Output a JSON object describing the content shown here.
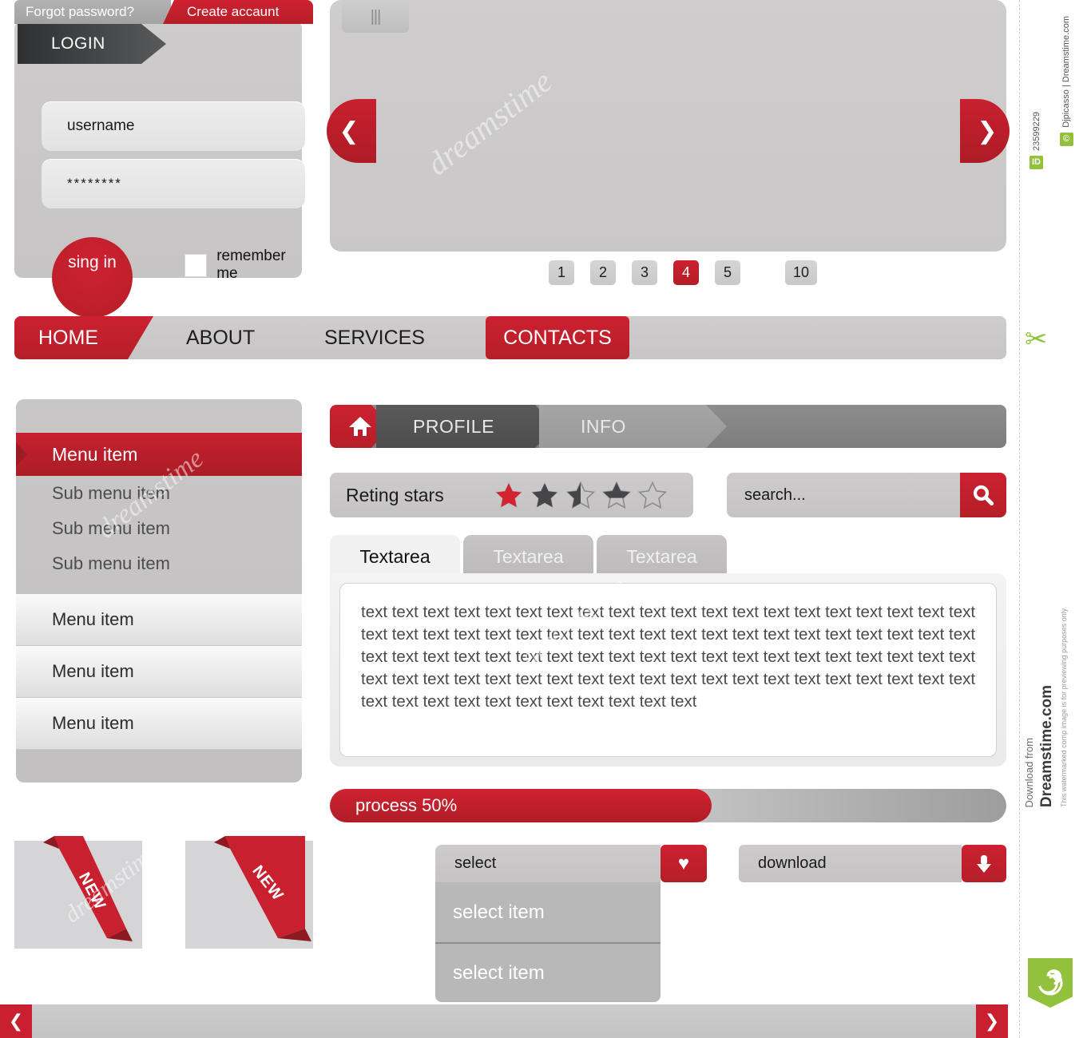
{
  "login": {
    "tab_forgot": "Forgot password?",
    "tab_create": "Create accaunt",
    "badge": "LOGIN",
    "username_value": "username",
    "password_value": "********",
    "signin_label": "sing in",
    "remember_label": "remember me"
  },
  "carousel": {
    "prev_icon": "chevron-left-icon",
    "next_icon": "chevron-right-icon",
    "prev_glyph": "❮",
    "next_glyph": "❯",
    "pages": [
      "1",
      "2",
      "3",
      "4",
      "5",
      "10"
    ],
    "active_page": "4"
  },
  "top_nav": {
    "home": "HOME",
    "about": "ABOUT",
    "services": "SERVICES",
    "contacts": "CONTACTS"
  },
  "sidebar": {
    "head": "Menu item",
    "sub_items": [
      "Sub menu item",
      "Sub menu item",
      "Sub menu item"
    ],
    "items": [
      "Menu item",
      "Menu item",
      "Menu item"
    ]
  },
  "breadcrumb": {
    "home_icon": "home-icon",
    "profile": "PROFILE",
    "info": "INFO"
  },
  "rating": {
    "label": "Reting stars",
    "stars": [
      "full-red",
      "full-dark",
      "half-dark",
      "partial-dark",
      "empty"
    ],
    "value": 3.5,
    "max": 5
  },
  "search": {
    "placeholder": "search...",
    "icon": "search-icon"
  },
  "textarea": {
    "tabs": [
      "Textarea",
      "Textarea",
      "Textarea"
    ],
    "active_index": 0,
    "content": "text text text text text text text text text text text text text text text text text text text text text text text text text text text text text text text text text text text text text text text text text text text text text text text text text text text text text text text text text text text text text text text text text text text text text text text text text text text text text text text text text text text text text text text text text text text"
  },
  "progress": {
    "label": "process 50%",
    "percent": 50
  },
  "ribbons": {
    "label_1": "NEW",
    "label_2": "NEW"
  },
  "select": {
    "header": "select",
    "fav_icon": "heart-icon",
    "fav_glyph": "♥",
    "options": [
      "select item",
      "select item"
    ]
  },
  "download": {
    "label": "download",
    "icon": "download-arrow-icon"
  },
  "scrollbar": {
    "left_glyph": "❮",
    "right_glyph": "❯",
    "thumb_glyph": "|||"
  },
  "watermark": {
    "image_id": "23599229",
    "credit": "Djpicasso | Dreamstime.com",
    "download_from": "Download from",
    "brand": "Dreamstime.com",
    "note": "This watermarked comp image is for previewing purposes only.",
    "id_chip": "ID",
    "copy_chip": "©",
    "tile_text": "dreamstime"
  },
  "colors": {
    "brand_red": "#c8202e",
    "dark_gray": "#4e4d4d",
    "panel_gray": "#c9c7c7",
    "accent_green": "#92c23c"
  }
}
